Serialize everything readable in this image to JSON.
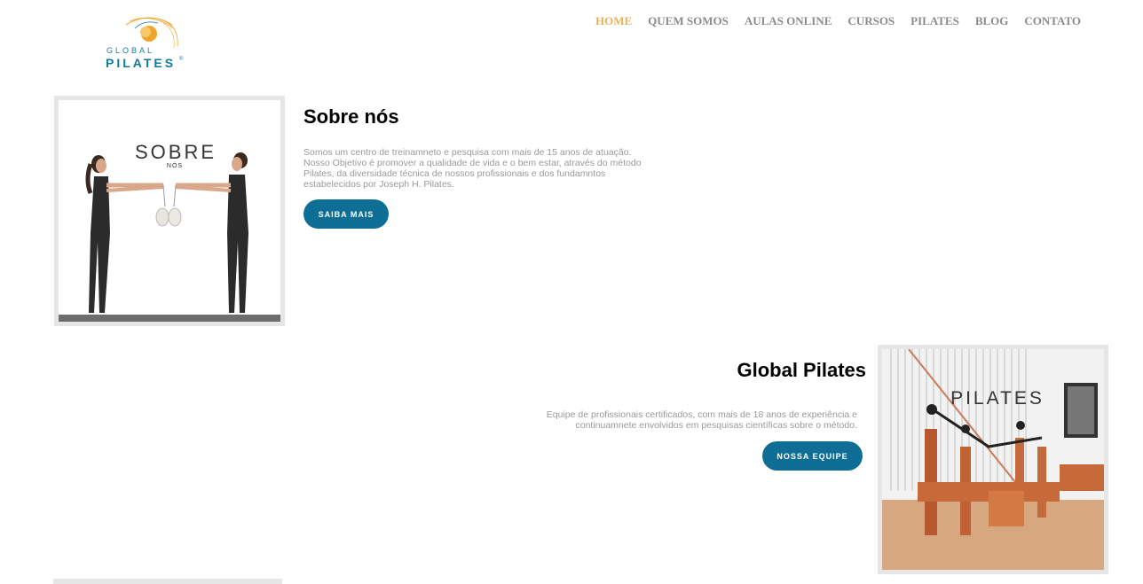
{
  "logo": {
    "line1": "GLOBAL",
    "line2": "PILATES",
    "reg": "®",
    "colors": {
      "primary": "#0e7aa0",
      "accent": "#f2a52b"
    }
  },
  "nav": {
    "items": [
      {
        "label": "HOME",
        "active": true
      },
      {
        "label": "QUEM SOMOS",
        "active": false
      },
      {
        "label": "AULAS ONLINE",
        "active": false
      },
      {
        "label": "CURSOS",
        "active": false
      },
      {
        "label": "PILATES",
        "active": false
      },
      {
        "label": "BLOG",
        "active": false
      },
      {
        "label": "CONTATO",
        "active": false
      }
    ],
    "active_color": "#e8b45a",
    "color": "#8c8c8c"
  },
  "section_about": {
    "image": {
      "title": "SOBRE",
      "subtitle": "NÓS"
    },
    "heading": "Sobre nós",
    "text": "Somos um centro de treinamneto e pesquisa com mais de 15 anos de atuação. Nosso Objetivo é promover a qualidade de vida e o bem estar, através do método Pilates, da diversidade técnica de nossos profissionais e dos fundamntos estabelecidos por Joseph H. Pilates.",
    "button": "SAIBA MAIS"
  },
  "section_global": {
    "heading": "Global Pilates",
    "text": "Equipe de profissionais certificados, com mais de 18 anos de experiência e continuamnete envolvidos em pesquisas científicas sobre o método.",
    "button": "NOSSA EQUIPE",
    "image": {
      "title": "PILATES"
    }
  },
  "colors": {
    "button": "#0e6e96",
    "body_text": "#9a9a9a"
  }
}
